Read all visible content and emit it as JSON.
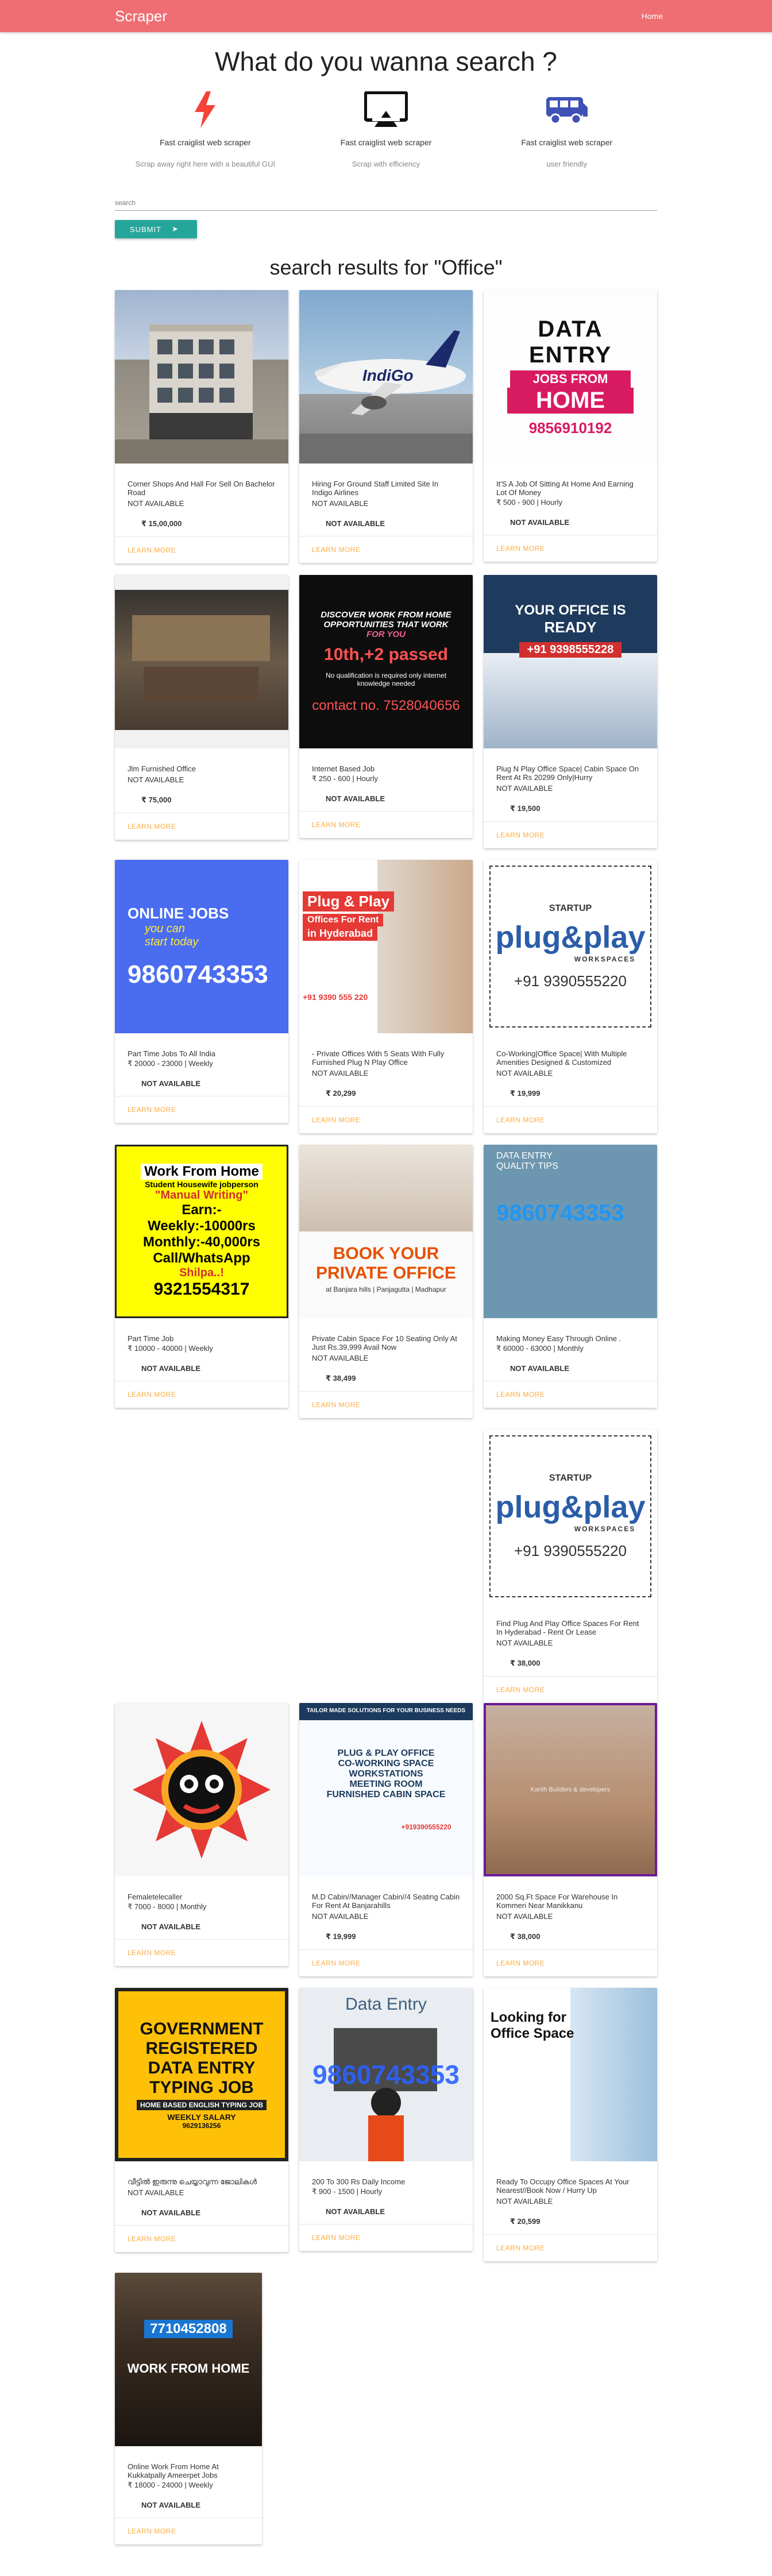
{
  "navbar": {
    "brand": "Scraper",
    "link": "Home"
  },
  "hero": {
    "title": "What do you wanna search ?"
  },
  "features": [
    {
      "icon": "bolt-icon",
      "title": "Fast craiglist web scraper",
      "text": "Scrap away right here with a beautiful GUI"
    },
    {
      "icon": "airplay-icon",
      "title": "Fast craiglist web scraper",
      "text": "Scrap with efficiency"
    },
    {
      "icon": "bus-icon",
      "title": "Fast craiglist web scraper",
      "text": "user friendly"
    }
  ],
  "search": {
    "placeholder": "search",
    "submit_label": "SUBMIT"
  },
  "results": {
    "heading": "search results for \"Office\""
  },
  "colors": {
    "navbar": "#ee6e73",
    "accent_red": "#f44336",
    "bus_blue": "#3f51b5",
    "submit": "#26a69a",
    "link": "#ffab40"
  },
  "learn_more": "LEARN MORE",
  "image_texts": {
    "c3_line1": "DATA",
    "c3_line2": "ENTRY",
    "c3_line3": "JOBS FROM",
    "c3_line4": "HOME",
    "c3_phone": "9856910192",
    "c5_line1": "DISCOVER WORK FROM HOME",
    "c5_line2": "OPPORTUNITIES THAT WORK",
    "c5_line3": "FOR YOU",
    "c5_line4": "10th,+2 passed",
    "c5_line5": "No qualification is required only internet knowledge needed",
    "c5_line6": "contact no. 7528040656",
    "c6_line1": "YOUR OFFICE IS",
    "c6_line2": "READY",
    "c6_phone": "+91 9398555228",
    "c7_line1": "ONLINE JOBS",
    "c7_line2": "you can",
    "c7_line3": "start today",
    "c7_phone": "9860743353",
    "c8_line1": "Plug & Play",
    "c8_line2": "Offices For Rent",
    "c8_line3": "in Hyderabad",
    "c8_phone": "+91 9390 555 220",
    "c9_brand": "STARTUP",
    "c9_line1": "plug&play",
    "c9_line2": "WORKSPACES",
    "c9_phone": "+91 9390555220",
    "c10_line1": "Work From Home",
    "c10_line2": "Student Housewife jobperson",
    "c10_line3": "\"Manual Writing\"",
    "c10_line4": "Earn:-",
    "c10_line5": "Weekly:-10000rs",
    "c10_line6": "Monthly:-40,000rs",
    "c10_line7": "Call/WhatsApp",
    "c10_line8": "Shilpa..!",
    "c10_phone": "9321554317",
    "c11_line1": "BOOK YOUR",
    "c11_line2": "PRIVATE OFFICE",
    "c11_line3": "at Banjara hills | Panjagutta | Madhapur",
    "c12_line1": "DATA ENTRY",
    "c12_line2": "QUALITY TIPS",
    "c12_phone": "9860743353",
    "c16_line1": "TAILOR MADE SOLUTIONS FOR YOUR BUSINESS NEEDS",
    "c16_line2": "PLUG & PLAY OFFICE",
    "c16_line3": "CO-WORKING SPACE",
    "c16_line4": "WORKSTATIONS",
    "c16_line5": "MEETING ROOM",
    "c16_line6": "FURNISHED CABIN SPACE",
    "c16_phone": "+919390555220",
    "c17_line1": "Kanth Builders & developers",
    "c18_line1": "GOVERNMENT",
    "c18_line2": "REGISTERED",
    "c18_line3": "DATA ENTRY",
    "c18_line4": "TYPING JOB",
    "c18_line5": "HOME BASED ENGLISH TYPING JOB",
    "c18_line6": "WEEKLY SALARY",
    "c18_phone": "9629136256",
    "c19_line1": "Data Entry",
    "c19_phone": "9860743353",
    "c20_line1": "Looking for",
    "c20_line2": "Office Space",
    "c21_phone": "7710452808",
    "c21_line1": "WORK FROM HOME"
  },
  "cards": [
    {
      "title": "Corner Shops And Hall For Sell On Bachelor Road",
      "price": "",
      "avail": "NOT AVAILABLE",
      "bold": "₹ 15,00,000"
    },
    {
      "title": "Hiring For Ground Staff Limited Site In Indigo Airlines",
      "price": "",
      "avail": "NOT AVAILABLE",
      "bold": "NOT AVAILABLE"
    },
    {
      "title": "It'S A Job Of Sitting At Home And Earning Lot Of Money",
      "price": "₹ 500 - 900 | Hourly",
      "avail": "",
      "bold": "NOT AVAILABLE"
    },
    {
      "title": "Jlm Furnished Office",
      "price": "",
      "avail": "NOT AVAILABLE",
      "bold": "₹ 75,000"
    },
    {
      "title": "Internet Based Job",
      "price": "₹ 250 - 600 | Hourly",
      "avail": "",
      "bold": "NOT AVAILABLE"
    },
    {
      "title": "Plug N Play Office Space| Cabin Space On Rent At Rs 20299 Only|Hurry",
      "price": "",
      "avail": "NOT AVAILABLE",
      "bold": "₹ 19,500"
    },
    {
      "title": "Part Time Jobs To All India",
      "price": "₹ 20000 - 23000 | Weekly",
      "avail": "",
      "bold": "NOT AVAILABLE"
    },
    {
      "title": "- Private Offices With 5 Seats With Fully Furnished Plug N Play Office",
      "price": "",
      "avail": "NOT AVAILABLE",
      "bold": "₹ 20,299"
    },
    {
      "title": "Co-Working|Office Space| With Multiple Amenities Designed & Customized",
      "price": "",
      "avail": "NOT AVAILABLE",
      "bold": "₹ 19,999"
    },
    {
      "title": "Part Time Job",
      "price": "₹ 10000 - 40000 | Weekly",
      "avail": "",
      "bold": "NOT AVAILABLE"
    },
    {
      "title": "Private Cabin Space For 10 Seating Only At Just Rs.39,999 Avail Now",
      "price": "",
      "avail": "NOT AVAILABLE",
      "bold": "₹ 38,499"
    },
    {
      "title": "Making Money Easy Through Online .",
      "price": "₹ 60000 - 63000 | Monthly",
      "avail": "",
      "bold": "NOT AVAILABLE"
    },
    {
      "title": "Find Plug And Play Office Spaces For Rent In Hyderabad - Rent Or Lease",
      "price": "",
      "avail": "NOT AVAILABLE",
      "bold": "₹ 38,000"
    },
    {
      "title": "Femaletelecaller",
      "price": "₹ 7000 - 8000 | Monthly",
      "avail": "",
      "bold": "NOT AVAILABLE"
    },
    {
      "title": "M.D Cabin//Manager Cabin//4 Seating Cabin For Rent At Banjarahills",
      "price": "",
      "avail": "NOT AVAILABLE",
      "bold": "₹ 19,999"
    },
    {
      "title": "2000 Sq.Ft Space For Warehouse In Kommeri Near Manikkanu",
      "price": "",
      "avail": "NOT AVAILABLE",
      "bold": "₹ 38,000"
    },
    {
      "title": "വീട്ടിൽ ഇരുന്നു ചെയ്യാവുന്ന ജോലികൾ",
      "price": "",
      "avail": "NOT AVAILABLE",
      "bold": "NOT AVAILABLE"
    },
    {
      "title": "200 To 300 Rs Daily Income",
      "price": "₹ 900 - 1500 | Hourly",
      "avail": "",
      "bold": "NOT AVAILABLE"
    },
    {
      "title": "Ready To Occupy Office Spaces At Your Nearest//Book Now / Hurry Up",
      "price": "",
      "avail": "NOT AVAILABLE",
      "bold": "₹ 20,599"
    },
    {
      "title": "Online Work From Home At Kukkatpally Ameerpet Jobs",
      "price": "₹ 18000 - 24000 | Weekly",
      "avail": "",
      "bold": "NOT AVAILABLE"
    }
  ]
}
